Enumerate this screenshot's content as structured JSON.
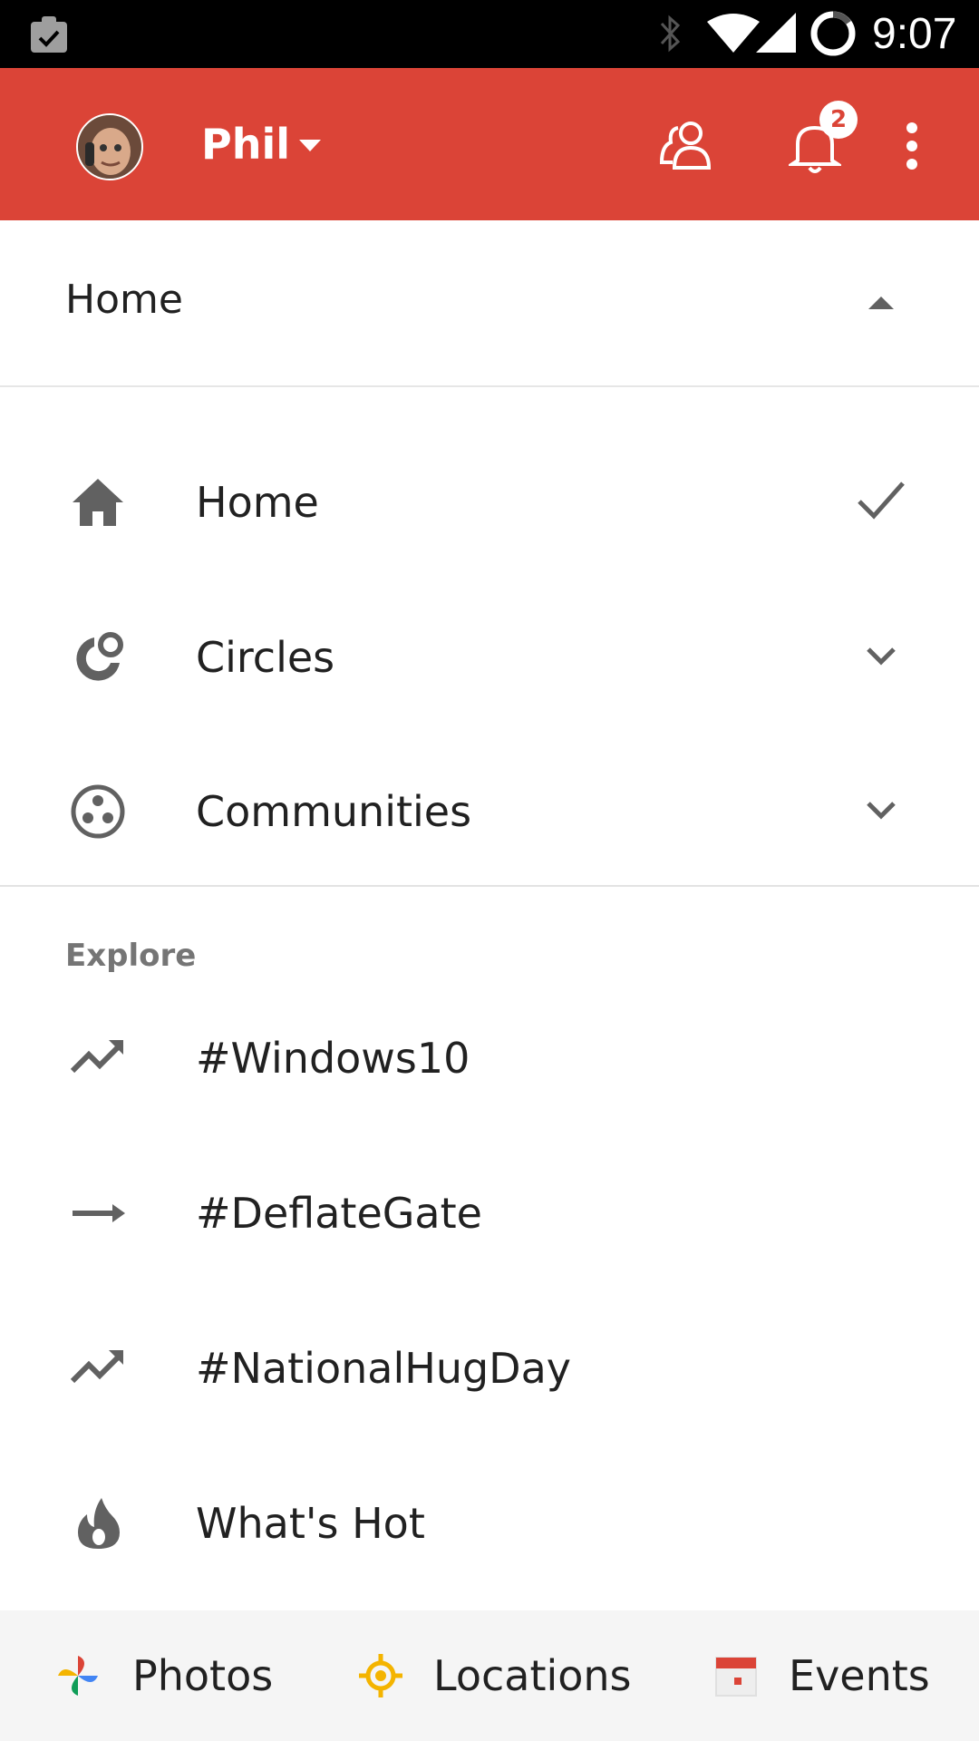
{
  "status_bar": {
    "time": "9:07",
    "icons": [
      "clipboard-check-icon",
      "bluetooth-icon",
      "wifi-icon",
      "signal-icon",
      "battery-icon"
    ]
  },
  "app_bar": {
    "account_name": "Phil",
    "notification_count": "2",
    "background_color": "#db4437",
    "icons": [
      "avatar",
      "account-dropdown-icon",
      "people-icon",
      "bell-icon",
      "more-vert-icon"
    ]
  },
  "stream_selector": {
    "title": "Home"
  },
  "nav": {
    "home": {
      "label": "Home",
      "icon": "home-icon",
      "trailing": "check-icon"
    },
    "circles": {
      "label": "Circles",
      "icon": "circles-icon",
      "trailing": "chevron-down-icon"
    },
    "communities": {
      "label": "Communities",
      "icon": "communities-icon",
      "trailing": "chevron-down-icon"
    }
  },
  "explore": {
    "heading": "Explore",
    "items": [
      {
        "label": "#Windows10",
        "icon": "trending-up-icon"
      },
      {
        "label": "#DeflateGate",
        "icon": "trending-flat-icon"
      },
      {
        "label": "#NationalHugDay",
        "icon": "trending-up-icon"
      },
      {
        "label": "What's Hot",
        "icon": "flame-icon"
      }
    ]
  },
  "bottom_bar": {
    "photos": "Photos",
    "locations": "Locations",
    "events": "Events"
  }
}
